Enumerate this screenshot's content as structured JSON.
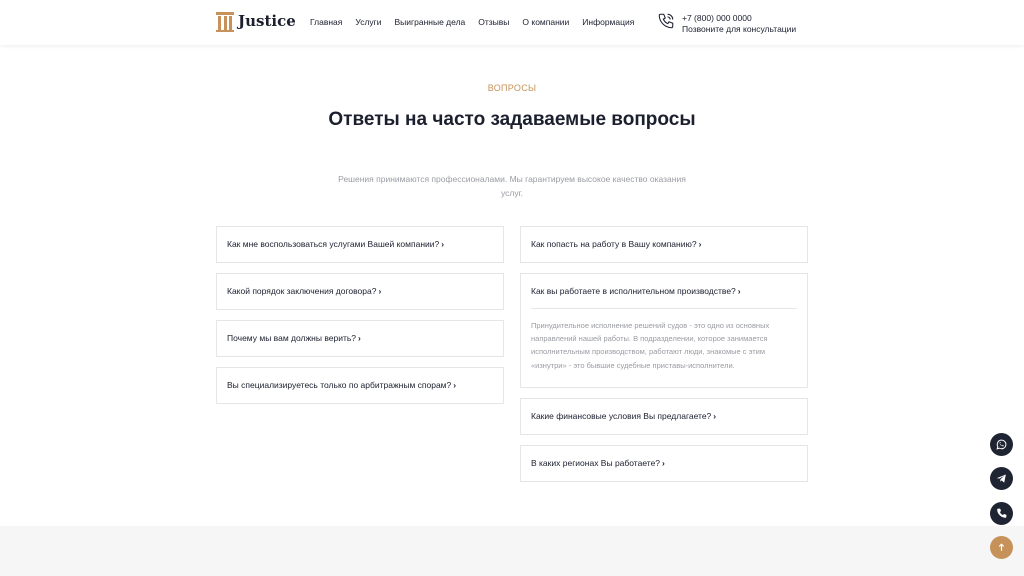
{
  "header": {
    "logo_text": "Justice",
    "nav": [
      "Главная",
      "Услуги",
      "Выигранные дела",
      "Отзывы",
      "О компании",
      "Информация"
    ],
    "phone": "+7 (800) 000 0000",
    "phone_caption": "Позвоните для консультации"
  },
  "section": {
    "eyebrow": "вопросы",
    "title": "Ответы на часто задаваемые вопросы",
    "subtitle": "Решения принимаются профессионалами. Мы гарантируем высокое качество оказания услуг."
  },
  "faq": {
    "left": [
      {
        "q": "Как мне воспользоваться услугами Вашей компании?"
      },
      {
        "q": "Какой порядок заключения договора?"
      },
      {
        "q": "Почему мы вам должны верить?"
      },
      {
        "q": "Вы специализируетесь только по арбитражным спорам?"
      }
    ],
    "right": [
      {
        "q": "Как попасть на работу в Вашу компанию?"
      },
      {
        "q": "Как вы работаете в исполнительном производстве?",
        "a": "Принудительное исполнение решений судов - это одно из основных направлений нашей работы. В подразделении, которое занимается исполнительным производством, работают люди, знакомые с этим «изнутри» - это бывшие судебные приставы-исполнители."
      },
      {
        "q": "Какие финансовые условия Вы предлагаете?"
      },
      {
        "q": "В каких регионах Вы работаете?"
      }
    ]
  },
  "icons": {
    "chevron": "›",
    "phone": "phone-icon",
    "whatsapp": "whatsapp-icon",
    "telegram": "telegram-icon",
    "call": "call-icon",
    "scroll_up": "arrow-up-icon"
  },
  "colors": {
    "accent": "#c6925a",
    "dark": "#1b1f2e",
    "muted": "#9a9ca3",
    "border": "#e6e6e8"
  }
}
